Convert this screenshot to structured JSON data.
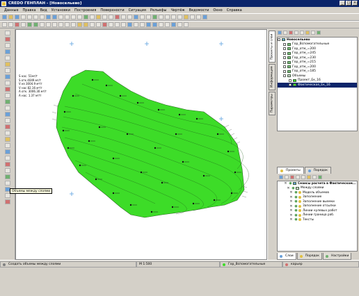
{
  "window": {
    "title": "CREDO ГЕНПЛАН - [Новосельево]"
  },
  "menu": [
    "Данные",
    "Правка",
    "Вид",
    "Установки",
    "Построения",
    "Поверхности",
    "Ситуация",
    "Рельефы",
    "Чертёж",
    "Ведомости",
    "Окно",
    "Справка"
  ],
  "canvas": {
    "info_lines": [
      "S нас. 51м²/т",
      "S отк 4049.м²/т",
      "V из 3004.9 м³/т",
      "V нас 82.16 м³/т",
      "A отк. 3006.30 м³/т",
      "A нас. 1.37 м³/т"
    ],
    "fill_color": "#3ddc28",
    "tooltip": "Объемы между слоями"
  },
  "side_tabs": [
    "Проекты и слои",
    "Информация",
    "Параметры"
  ],
  "layers_tree": {
    "root": "Новосельево",
    "items": [
      "Гор_Вспомогательные",
      "Гор_отм_=200",
      "Гор_отм_=245",
      "Гор_отм_=230",
      "Гор_отм_=215",
      "Гор_отм_=200",
      "Гор_отм_=185",
      "Объемы",
      "Проект_Ек_16",
      "Фактическая_Ек_16"
    ]
  },
  "panel_tabs": {
    "left": "Проекты",
    "right": "Порядок"
  },
  "volumes_tree": {
    "root": "Сеансы расчета в Фактическом...",
    "group": "Между слоями",
    "items": [
      "Модель объемов",
      "Заполнение",
      "Заполнение выемки",
      "Заполнение отсыпки",
      "Линии нулевых работ",
      "Линии граница раб.",
      "Тексты"
    ]
  },
  "bottom_tabs": [
    "Слои",
    "Порядок",
    "Настройки"
  ],
  "status": {
    "hint": "Создать объемы между слоями",
    "scale": "М 1:500",
    "layer": "Гор_Вспомогательные",
    "mode": "карьер"
  }
}
